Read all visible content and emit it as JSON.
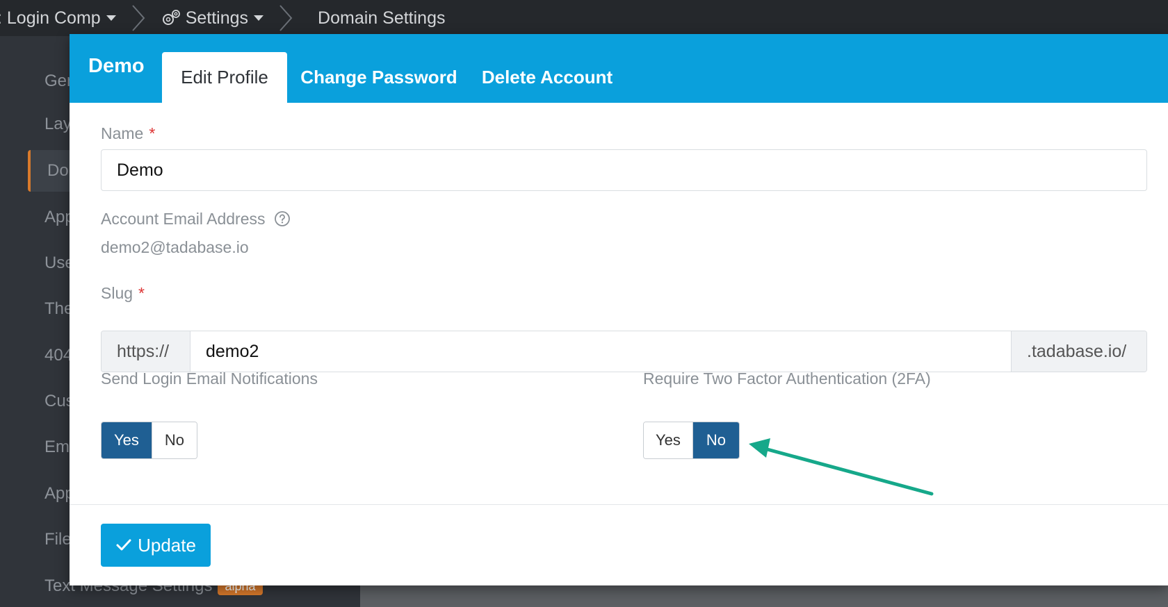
{
  "breadcrumb": {
    "app": ": Login Comp",
    "settings": "Settings",
    "current": "Domain Settings"
  },
  "sidebar": {
    "items": [
      {
        "label": "General"
      },
      {
        "label": "Layouts"
      },
      {
        "label": "Domain Settings",
        "active": true
      },
      {
        "label": "App"
      },
      {
        "label": "Users"
      },
      {
        "label": "Themes"
      },
      {
        "label": "404"
      },
      {
        "label": "Custom"
      },
      {
        "label": "Email"
      },
      {
        "label": "App"
      },
      {
        "label": "Files"
      },
      {
        "label": "Text Message Settings",
        "badge": "alpha"
      }
    ]
  },
  "modal": {
    "title": "Demo",
    "tabs": [
      {
        "label": "Edit Profile",
        "active": true
      },
      {
        "label": "Change Password"
      },
      {
        "label": "Delete Account"
      }
    ],
    "form": {
      "name_label": "Name",
      "name_value": "Demo",
      "email_label": "Account Email Address",
      "email_value": "demo2@tadabase.io",
      "slug_label": "Slug",
      "slug_prefix": "https://",
      "slug_value": "demo2",
      "slug_suffix": ".tadabase.io/",
      "required_mark": "*",
      "login_notify_label": "Send Login Email Notifications",
      "login_notify_yes": "Yes",
      "login_notify_no": "No",
      "login_notify_selected": "Yes",
      "twofa_label": "Require Two Factor Authentication (2FA)",
      "twofa_yes": "Yes",
      "twofa_no": "No",
      "twofa_selected": "No"
    },
    "update_button": "Update"
  },
  "colors": {
    "header": "#0aa0dc",
    "toggle_on": "#1f5f93",
    "annotation_arrow": "#16a88a",
    "sidebar_accent": "#d97a2b"
  }
}
